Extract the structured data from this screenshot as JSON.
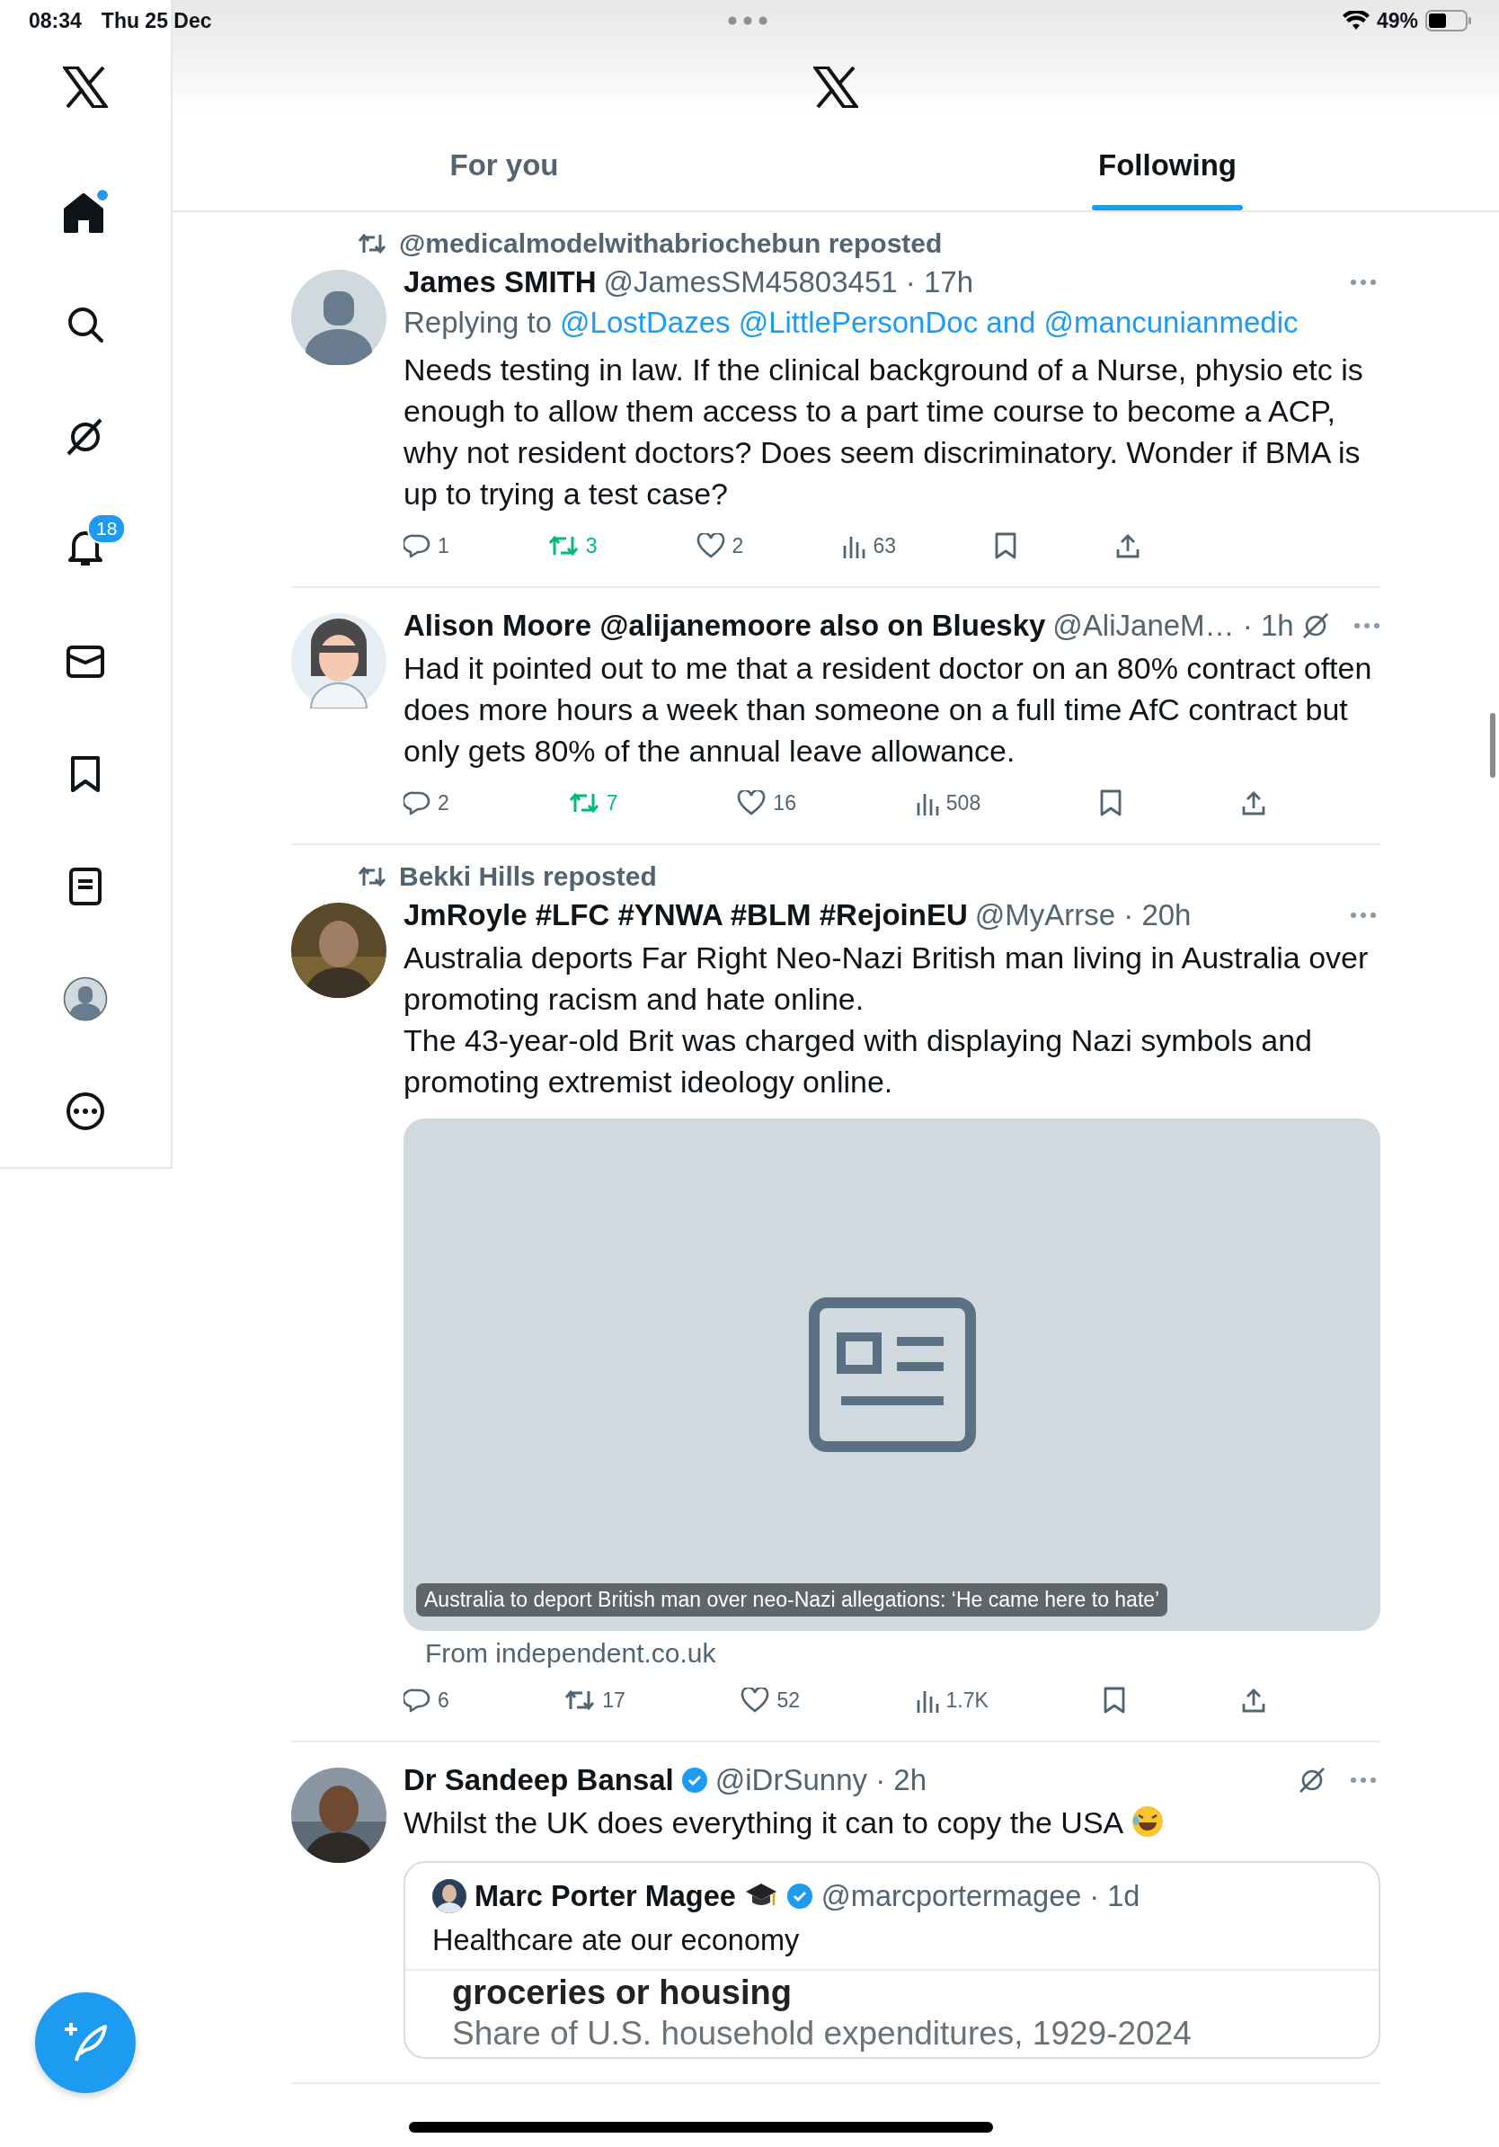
{
  "status_bar": {
    "time": "08:34",
    "date": "Thu 25 Dec",
    "battery": "49%"
  },
  "sidebar": {
    "items": [
      {
        "kind": "logo"
      },
      {
        "kind": "home",
        "selected": true,
        "dot": true
      },
      {
        "kind": "search",
        "selected": false
      },
      {
        "kind": "grok",
        "selected": false
      },
      {
        "kind": "notifications",
        "selected": false,
        "badge": "18"
      },
      {
        "kind": "messages",
        "selected": false
      },
      {
        "kind": "bookmarks",
        "selected": false
      },
      {
        "kind": "lists",
        "selected": false
      },
      {
        "kind": "profile",
        "selected": false
      },
      {
        "kind": "more",
        "selected": false
      }
    ]
  },
  "tabs": [
    {
      "label": "For you",
      "selected": false
    },
    {
      "label": "Following",
      "selected": true
    }
  ],
  "posts": [
    {
      "reposted_by": "@medicalmodelwithabriochebun reposted",
      "avatar": {
        "kind": "default"
      },
      "name": "James SMITH",
      "meta": "@JamesSM45803451 · 17h",
      "replying_prefix": "Replying to",
      "replying_users": "@LostDazes @LittlePersonDoc and @mancunianmedic",
      "body": [
        "Needs testing in law. If the clinical background of a Nurse, physio etc is enough to allow them access to a part time course to become a ACP, why not resident doctors? Does seem discriminatory. Wonder if BMA is up to trying a  test case?"
      ],
      "stats": {
        "replies": "1",
        "reposts": "3",
        "likes": "2",
        "views": "63",
        "reposted": true
      }
    },
    {
      "avatar": {
        "kind": "cartoon"
      },
      "name": "Alison Moore @alijanemoore also on Bluesky",
      "meta": "@AliJaneM… · 1h",
      "grok": true,
      "body": [
        "Had it pointed out to me that a resident doctor on an 80% contract often does more hours a week than someone on a full time AfC contract but only gets 80% of the annual leave allowance."
      ],
      "stats": {
        "replies": "2",
        "reposts": "7",
        "likes": "16",
        "views": "508",
        "reposted": true
      }
    },
    {
      "reposted_by": "Bekki Hills reposted",
      "avatar": {
        "kind": "picture"
      },
      "name": "JmRoyle #LFC #YNWA #BLM #RejoinEU",
      "meta": "@MyArrse · 20h",
      "body": [
        "Australia deports Far Right Neo-Nazi British man living in Australia over promoting racism and hate online.",
        "The 43-year-old Brit was charged with displaying Nazi symbols and promoting extremist ideology online."
      ],
      "link_card": {
        "caption": "Australia to deport British man over neo-Nazi allegations: ‘He came here to hate’",
        "source": "From independent.co.uk"
      },
      "stats": {
        "replies": "6",
        "reposts": "17",
        "likes": "52",
        "views": "1.7K",
        "reposted": false
      }
    },
    {
      "avatar": {
        "kind": "picture"
      },
      "name": "Dr Sandeep Bansal",
      "verified": true,
      "meta": "@iDrSunny · 2h",
      "grok": true,
      "body": [
        "Whilst the UK does everything it can to copy the USA"
      ],
      "emoji": true,
      "quote": {
        "name": "Marc Porter Magee",
        "cap": true,
        "verified": true,
        "meta": "@marcportermagee · 1d",
        "body": "Healthcare ate our economy",
        "media_title": "groceries or housing",
        "media_subtitle": "Share of U.S. household expenditures, 1929-2024"
      }
    }
  ]
}
